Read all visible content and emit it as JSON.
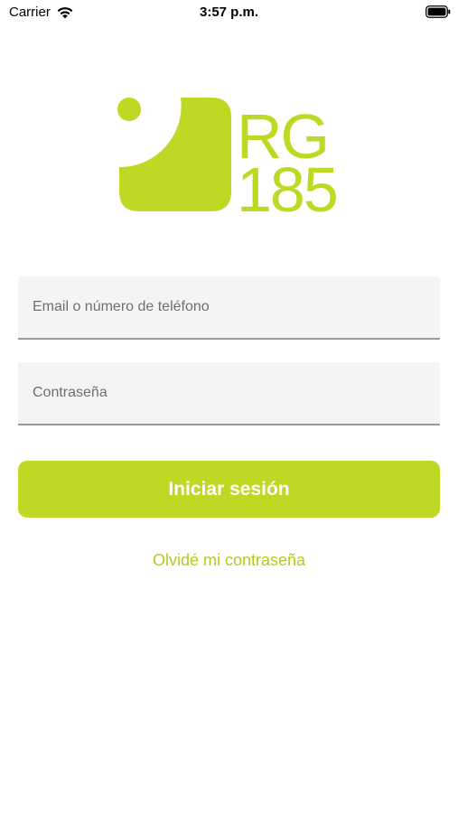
{
  "status_bar": {
    "carrier": "Carrier",
    "time": "3:57 p.m.",
    "icons": [
      "wifi-icon",
      "battery-icon"
    ]
  },
  "brand": {
    "name_line1": "RG",
    "name_line2": "185",
    "accent_color": "#bfd823"
  },
  "form": {
    "email_placeholder": "Email o número de teléfono",
    "email_value": "",
    "password_placeholder": "Contraseña",
    "password_value": "",
    "login_label": "Iniciar sesión",
    "forgot_label": "Olvidé mi contraseña"
  }
}
